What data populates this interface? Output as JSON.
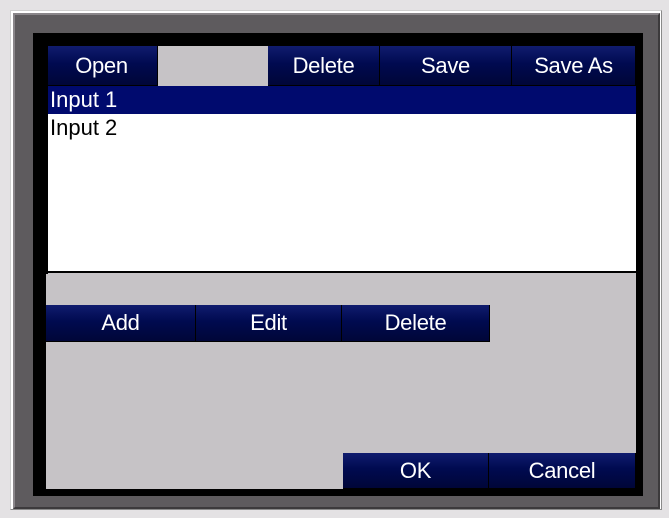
{
  "file_toolbar": {
    "open_label": "Open",
    "delete_label": "Delete",
    "save_label": "Save",
    "save_as_label": "Save As"
  },
  "input_list": {
    "items": [
      {
        "label": "Input 1",
        "selected": true
      },
      {
        "label": "Input 2",
        "selected": false
      }
    ]
  },
  "edit_toolbar": {
    "add_label": "Add",
    "edit_label": "Edit",
    "delete_label": "Delete"
  },
  "dialog_buttons": {
    "ok_label": "OK",
    "cancel_label": "Cancel"
  },
  "colors": {
    "button_navy": "#000a50",
    "selection": "#000a6e",
    "panel_gray": "#c6c3c6",
    "bezel": "#5e5b5e"
  }
}
